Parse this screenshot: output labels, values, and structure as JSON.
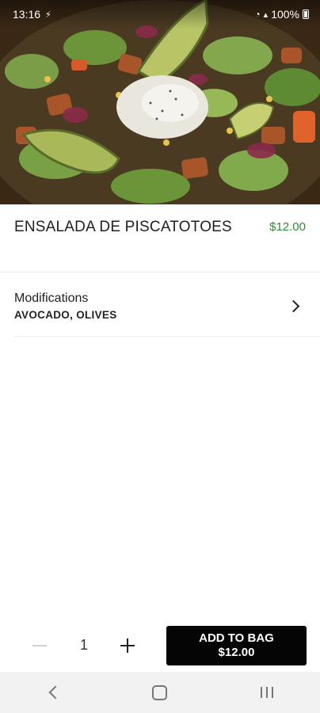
{
  "status_bar": {
    "time": "13:16",
    "battery": "100%",
    "icons": [
      "charging-bolt-icon",
      "wifi-icon",
      "signal-icon",
      "battery-icon"
    ]
  },
  "hero": {
    "image_subject": "salad-photo"
  },
  "item": {
    "title": "ENSALADA DE PISCATOTOES",
    "price": "$12.00"
  },
  "modifications": {
    "label": "Modifications",
    "value": "AVOCADO, OLIVES"
  },
  "quantity": {
    "value": "1"
  },
  "add_to_bag": {
    "line1": "ADD TO BAG",
    "line2": "$12.00"
  },
  "colors": {
    "price_green": "#2e8b3c",
    "button_black": "#050505",
    "nav_bar_bg": "#f2f2f2"
  }
}
